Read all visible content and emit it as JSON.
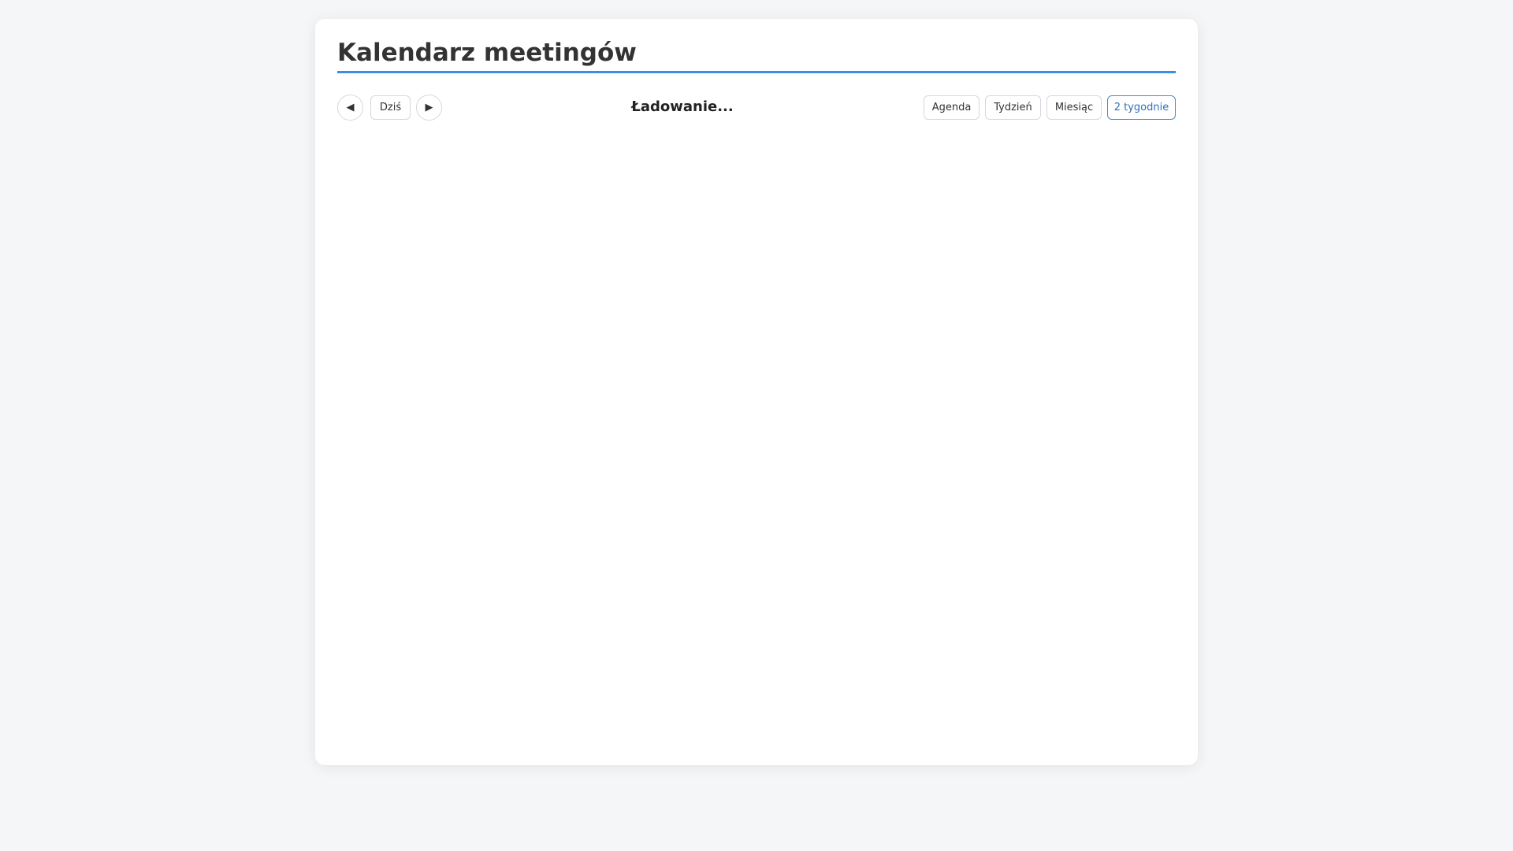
{
  "page": {
    "title": "Kalendarz meetingów"
  },
  "toolbar": {
    "prev_icon": "◀",
    "today_label": "Dziś",
    "next_icon": "▶",
    "range_label": "Ładowanie...",
    "views": [
      {
        "label": "Agenda",
        "active": false
      },
      {
        "label": "Tydzień",
        "active": false
      },
      {
        "label": "Miesiąc",
        "active": false
      },
      {
        "label": "2 tygodnie",
        "active": true
      }
    ]
  },
  "colors": {
    "accent": "#3d8de0",
    "background": "#f5f6f8",
    "card": "#ffffff"
  }
}
